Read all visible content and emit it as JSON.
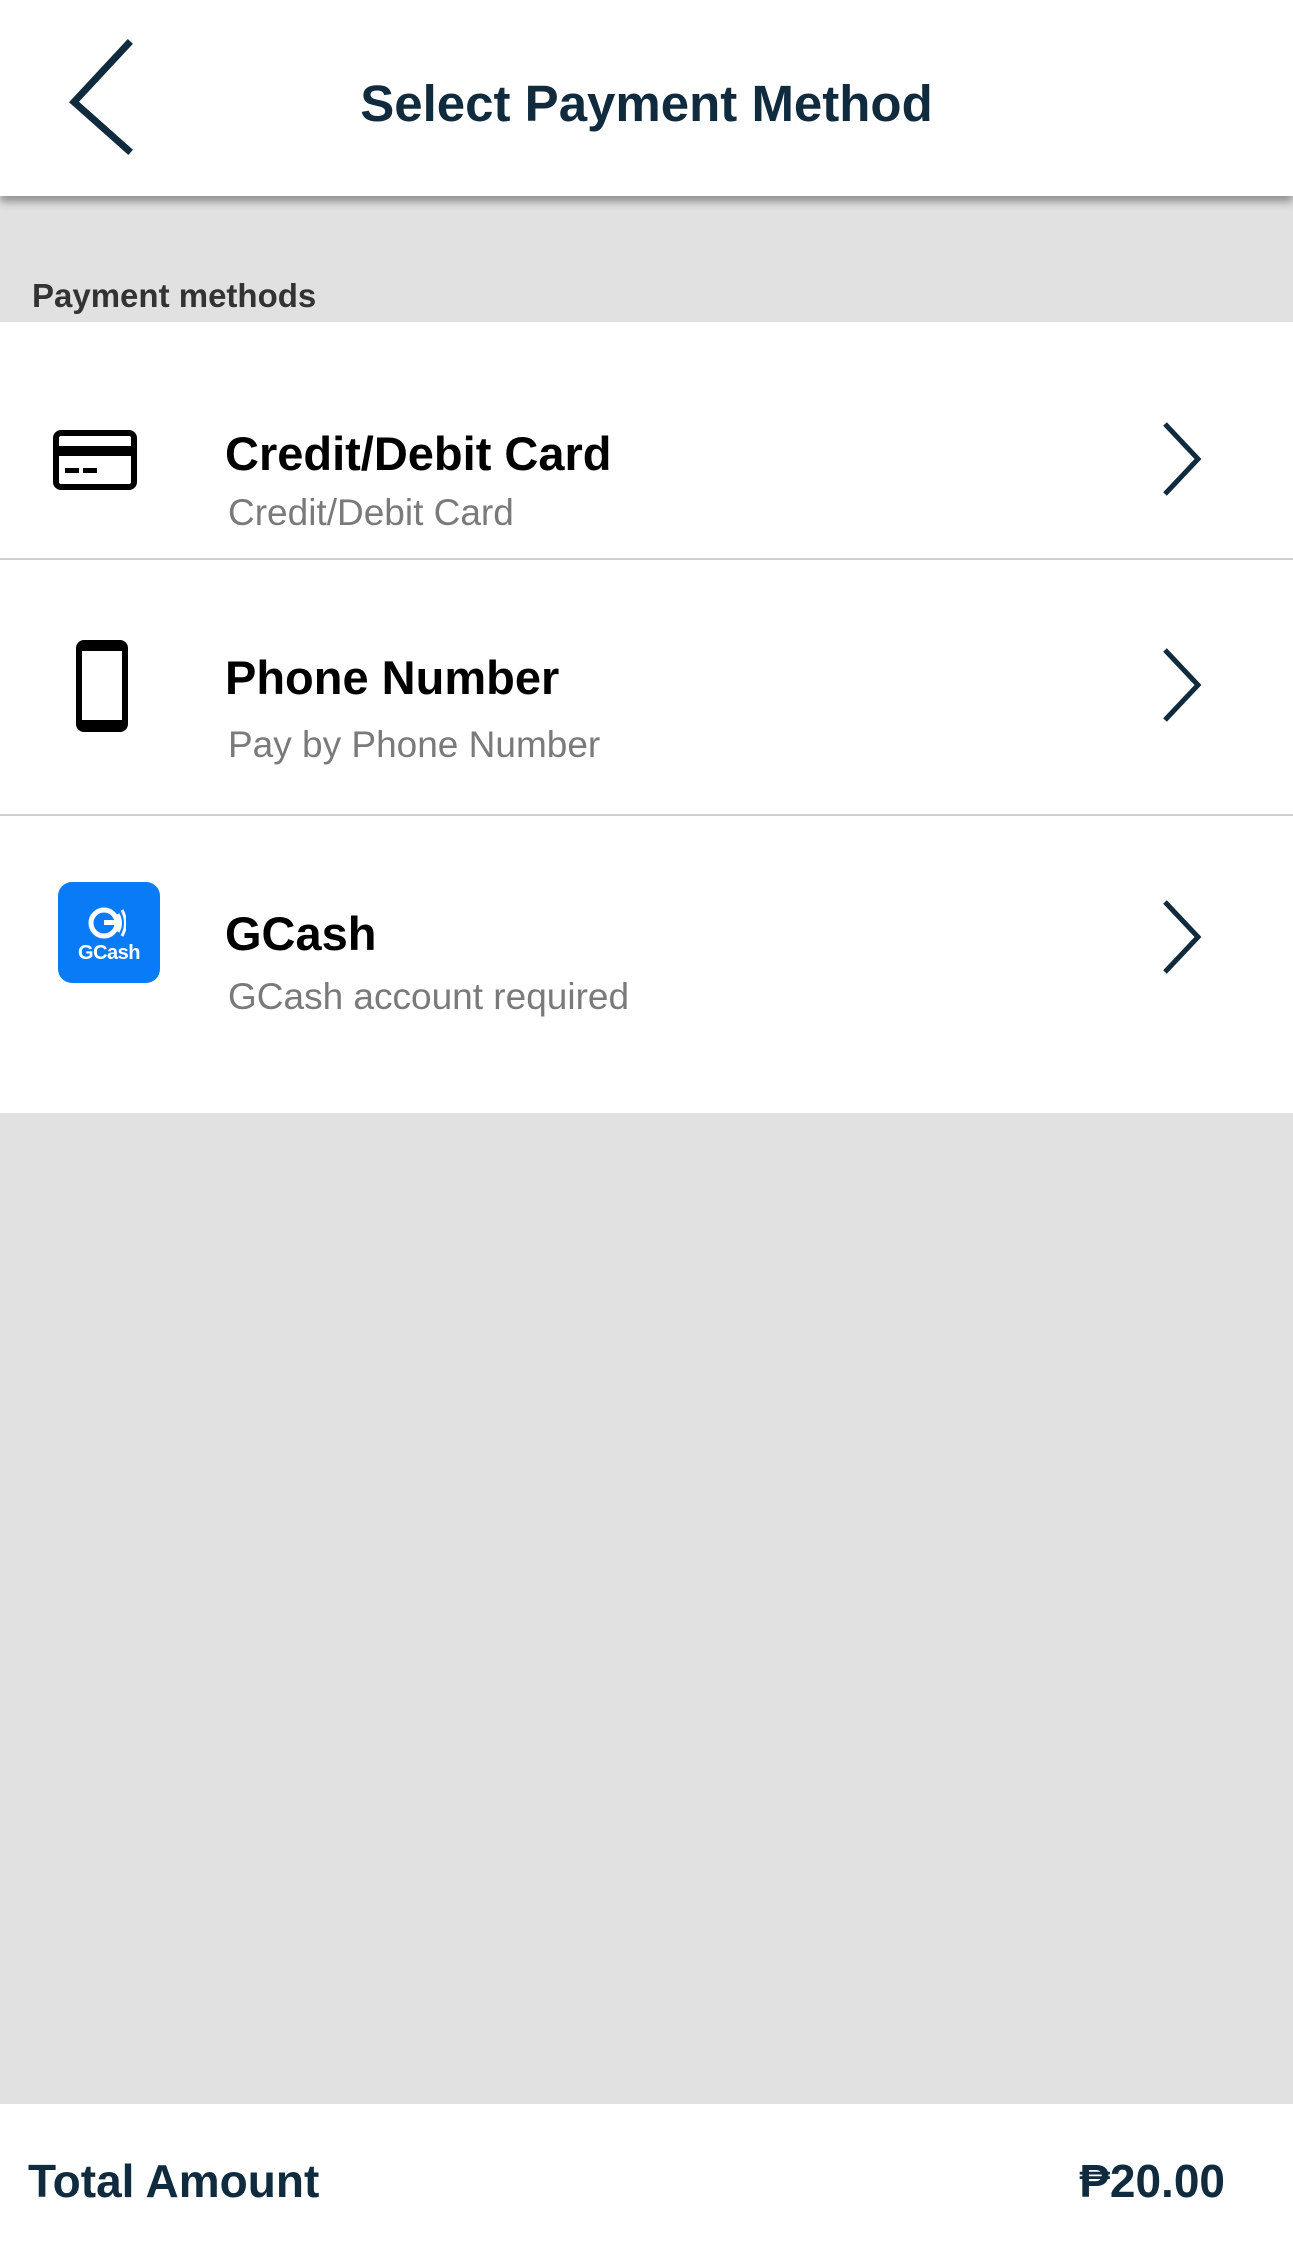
{
  "header": {
    "title": "Select Payment Method"
  },
  "section": {
    "label": "Payment methods"
  },
  "payment_methods": [
    {
      "title": "Credit/Debit Card",
      "subtitle": "Credit/Debit Card",
      "icon": "credit-card-icon"
    },
    {
      "title": "Phone Number",
      "subtitle": "Pay by Phone Number",
      "icon": "phone-icon"
    },
    {
      "title": "GCash",
      "subtitle": "GCash account required",
      "icon": "gcash-logo",
      "logo_text": "GCash"
    }
  ],
  "footer": {
    "total_label": "Total Amount",
    "total_value": "₱20.00"
  },
  "colors": {
    "primary_text": "#0f2b3d",
    "background": "#e1e1e1",
    "gcash_blue": "#0a7bf7",
    "subtitle_gray": "#7a7a7a"
  }
}
